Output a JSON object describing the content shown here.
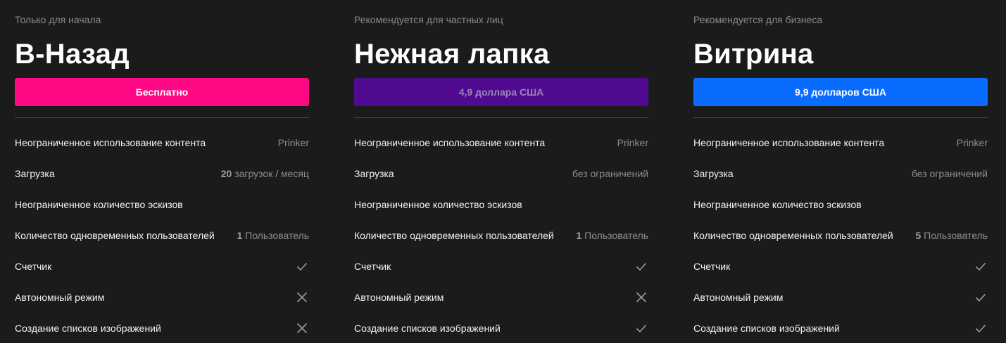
{
  "colors": {
    "background": "#1b1b1c",
    "plan_0_button": "#ff0a84",
    "plan_1_button": "#500a91",
    "plan_2_button": "#0a6cff"
  },
  "plans": [
    {
      "subtitle": "Только для начала",
      "title": "В-Назад",
      "price": "Бесплатно",
      "features": [
        {
          "label": "Неограниченное использование контента",
          "value": "Prinker"
        },
        {
          "label": "Загрузка",
          "strong": "20",
          "value": " загрузок / месяц"
        },
        {
          "label": "Неограниченное количество эскизов"
        },
        {
          "label": "Количество одновременных пользователей",
          "strong": "1",
          "value": " Пользователь"
        },
        {
          "label": "Счетчик",
          "icon": "check-icon"
        },
        {
          "label": "Автономный режим",
          "icon": "cross-icon"
        },
        {
          "label": "Создание списков изображений",
          "icon": "cross-icon"
        }
      ]
    },
    {
      "subtitle": "Рекомендуется для частных лиц",
      "title": "Нежная лапка",
      "price": "4,9 доллара США",
      "features": [
        {
          "label": "Неограниченное использование контента",
          "value": "Prinker"
        },
        {
          "label": "Загрузка",
          "value": "без ограничений"
        },
        {
          "label": "Неограниченное количество эскизов"
        },
        {
          "label": "Количество одновременных пользователей",
          "strong": "1",
          "value": " Пользователь"
        },
        {
          "label": "Счетчик",
          "icon": "check-icon"
        },
        {
          "label": "Автономный режим",
          "icon": "cross-icon"
        },
        {
          "label": "Создание списков изображений",
          "icon": "check-icon"
        }
      ]
    },
    {
      "subtitle": "Рекомендуется для бизнеса",
      "title": "Витрина",
      "price": "9,9 долларов США",
      "features": [
        {
          "label": "Неограниченное использование контента",
          "value": "Prinker"
        },
        {
          "label": "Загрузка",
          "value": "без ограничений"
        },
        {
          "label": "Неограниченное количество эскизов"
        },
        {
          "label": "Количество одновременных пользователей",
          "strong": "5",
          "value": " Пользователь"
        },
        {
          "label": "Счетчик",
          "icon": "check-icon"
        },
        {
          "label": "Автономный режим",
          "icon": "check-icon"
        },
        {
          "label": "Создание списков изображений",
          "icon": "check-icon"
        }
      ]
    }
  ]
}
